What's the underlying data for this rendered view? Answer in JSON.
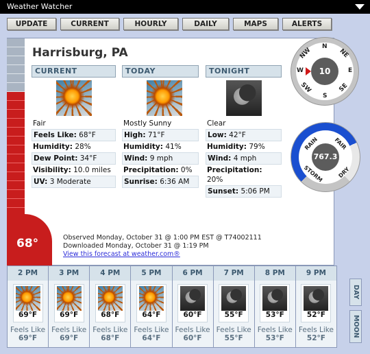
{
  "window": {
    "title": "Weather Watcher"
  },
  "toolbar": [
    "UPDATE",
    "CURRENT",
    "HOURLY",
    "DAILY",
    "MAPS",
    "ALERTS"
  ],
  "location": "Harrisburg, PA",
  "thermometer": {
    "temp": "68°"
  },
  "current": {
    "header": "CURRENT",
    "icon": "sun-icon",
    "condition": "Fair",
    "feels_like": {
      "label": "Feels Like:",
      "value": "68°F"
    },
    "humidity": {
      "label": "Humidity:",
      "value": "28%"
    },
    "dew_point": {
      "label": "Dew Point:",
      "value": "34°F"
    },
    "visibility": {
      "label": "Visibility:",
      "value": "10.0 miles"
    },
    "uv": {
      "label": "UV:",
      "value": "3 Moderate"
    }
  },
  "today": {
    "header": "TODAY",
    "icon": "sun-icon",
    "condition": "Mostly Sunny",
    "high": {
      "label": "High:",
      "value": "71°F"
    },
    "humidity": {
      "label": "Humidity:",
      "value": "41%"
    },
    "wind": {
      "label": "Wind:",
      "value": "9 mph"
    },
    "precip": {
      "label": "Precipitation:",
      "value": "0%"
    },
    "sunrise": {
      "label": "Sunrise:",
      "value": "6:36 AM"
    }
  },
  "tonight": {
    "header": "TONIGHT",
    "icon": "moon-icon",
    "condition": "Clear",
    "low": {
      "label": "Low:",
      "value": "42°F"
    },
    "humidity": {
      "label": "Humidity:",
      "value": "79%"
    },
    "wind": {
      "label": "Wind:",
      "value": "4 mph"
    },
    "precip": {
      "label": "Precipitation:",
      "value": "20%"
    },
    "sunset": {
      "label": "Sunset:",
      "value": "5:06 PM"
    }
  },
  "observation": {
    "observed": "Observed Monday, October 31 @ 1:00 PM EST @ T74002111",
    "downloaded": "Downloaded Monday, October 31 @ 1:19 PM",
    "link": "View this forecast at weather.com®"
  },
  "compass": {
    "speed": "10",
    "direction": "W",
    "labels": {
      "n": "N",
      "ne": "NE",
      "e": "E",
      "se": "SE",
      "s": "S",
      "sw": "SW",
      "w": "W",
      "nw": "NW"
    }
  },
  "barometer": {
    "value": "767.3",
    "labels": {
      "rain": "RAIN",
      "fair": "FAIR",
      "storm": "STORM",
      "dry": "DRY"
    }
  },
  "hourly": [
    {
      "time": "2 PM",
      "icon": "sun-icon",
      "temp": "69°F",
      "feels_label": "Feels Like",
      "feels": "69°F"
    },
    {
      "time": "3 PM",
      "icon": "sun-icon",
      "temp": "69°F",
      "feels_label": "Feels Like",
      "feels": "69°F"
    },
    {
      "time": "4 PM",
      "icon": "sun-icon",
      "temp": "68°F",
      "feels_label": "Feels Like",
      "feels": "68°F"
    },
    {
      "time": "5 PM",
      "icon": "sun-icon",
      "temp": "64°F",
      "feels_label": "Feels Like",
      "feels": "64°F"
    },
    {
      "time": "6 PM",
      "icon": "moon-icon",
      "temp": "60°F",
      "feels_label": "Feels Like",
      "feels": "60°F"
    },
    {
      "time": "7 PM",
      "icon": "moon-icon",
      "temp": "55°F",
      "feels_label": "Feels Like",
      "feels": "55°F"
    },
    {
      "time": "8 PM",
      "icon": "moon-icon",
      "temp": "53°F",
      "feels_label": "Feels Like",
      "feels": "53°F"
    },
    {
      "time": "9 PM",
      "icon": "moon-icon",
      "temp": "52°F",
      "feels_label": "Feels Like",
      "feels": "52°F"
    }
  ],
  "side_tabs": {
    "day": "DAY",
    "moon": "MOON"
  },
  "colors": {
    "accent_red": "#c81d1d",
    "panel_bg": "#c7d1ea",
    "header_bg": "#d6e2ea",
    "barometer_blue": "#1a4fd0"
  }
}
